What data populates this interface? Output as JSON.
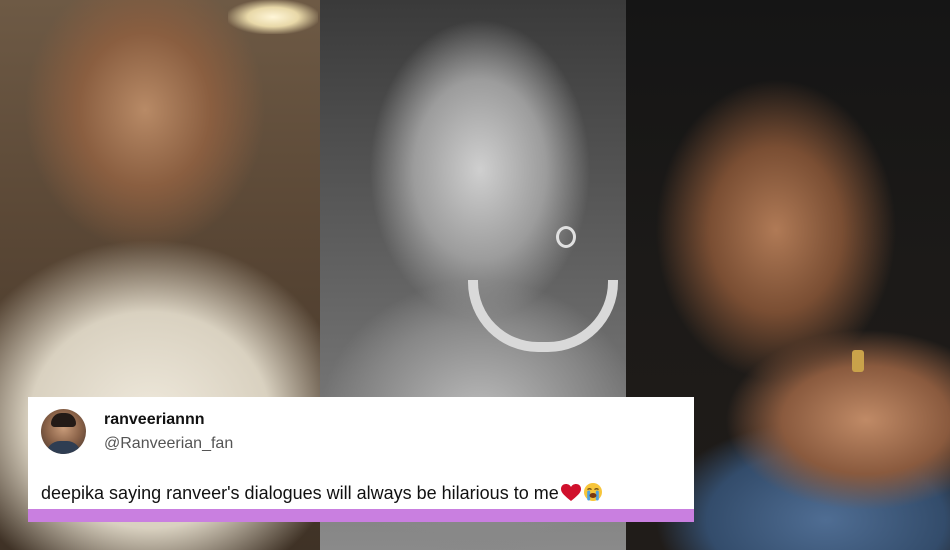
{
  "panels": [
    {
      "name": "left-photo"
    },
    {
      "name": "middle-photo"
    },
    {
      "name": "right-photo"
    }
  ],
  "tweet": {
    "display_name": "ranveeriannn",
    "handle": "@Ranveerian_fan",
    "text": "deepika saying ranveer's dialogues will always be hilarious to me",
    "emojis": [
      "red-heart-icon",
      "loudly-crying-face-icon"
    ]
  },
  "colors": {
    "card_background": "#ffffff",
    "accent_bar": "#c97fe0",
    "heart": "#d0102c"
  }
}
